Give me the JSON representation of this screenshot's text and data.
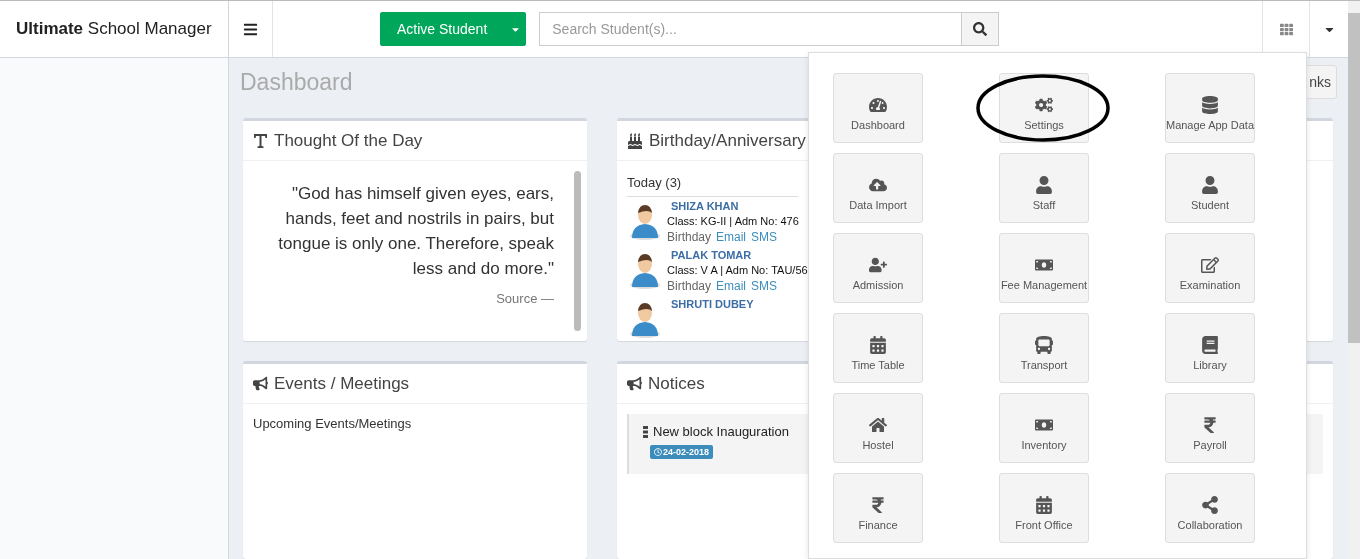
{
  "header": {
    "brand": "**Ultimate** School Manager",
    "student_filter": "Active Student",
    "search": {
      "placeholder": "Search Student(s)..."
    }
  },
  "page_title": "Dashboard",
  "links_button": "nks",
  "thought": {
    "title": "Thought Of the Day",
    "quote": "\"God has himself given eyes, ears, hands, feet and nostrils in pairs, but tongue is only one. Therefore, speak less and do more.\"",
    "source": "Source —"
  },
  "birthdays": {
    "title": "Birthday/Anniversary",
    "group": "Today (3)",
    "people": [
      {
        "name": "SHIZA KHAN",
        "details": "Class: KG-II | Adm No: 476",
        "occasion": "Birthday",
        "actions": [
          "Email",
          "SMS"
        ]
      },
      {
        "name": "PALAK TOMAR",
        "details": "Class: V A | Adm No: TAU/56",
        "occasion": "Birthday",
        "actions": [
          "Email",
          "SMS"
        ]
      },
      {
        "name": "SHRUTI DUBEY"
      }
    ]
  },
  "events": {
    "title": "Events / Meetings",
    "subtitle": "Upcoming Events/Meetings"
  },
  "notices": {
    "title": "Notices",
    "items": [
      {
        "title": "New block Inauguration",
        "date": "24-02-2018"
      }
    ]
  },
  "app_menu": {
    "tiles": [
      {
        "label": "Dashboard",
        "circled": false
      },
      {
        "label": "Settings",
        "circled": true
      },
      {
        "label": "Manage App Data",
        "circled": false
      },
      {
        "label": "Data Import",
        "circled": false
      },
      {
        "label": "Staff",
        "circled": false
      },
      {
        "label": "Student",
        "circled": false
      },
      {
        "label": "Admission",
        "circled": false
      },
      {
        "label": "Fee Management",
        "circled": false
      },
      {
        "label": "Examination",
        "circled": false
      },
      {
        "label": "Time Table",
        "circled": false
      },
      {
        "label": "Transport",
        "circled": false
      },
      {
        "label": "Library",
        "circled": false
      },
      {
        "label": "Hostel",
        "circled": false
      },
      {
        "label": "Inventory",
        "circled": false
      },
      {
        "label": "Payroll",
        "circled": false
      },
      {
        "label": "Finance",
        "circled": false
      },
      {
        "label": "Front Office",
        "circled": false
      },
      {
        "label": "Collaboration",
        "circled": false
      }
    ]
  }
}
